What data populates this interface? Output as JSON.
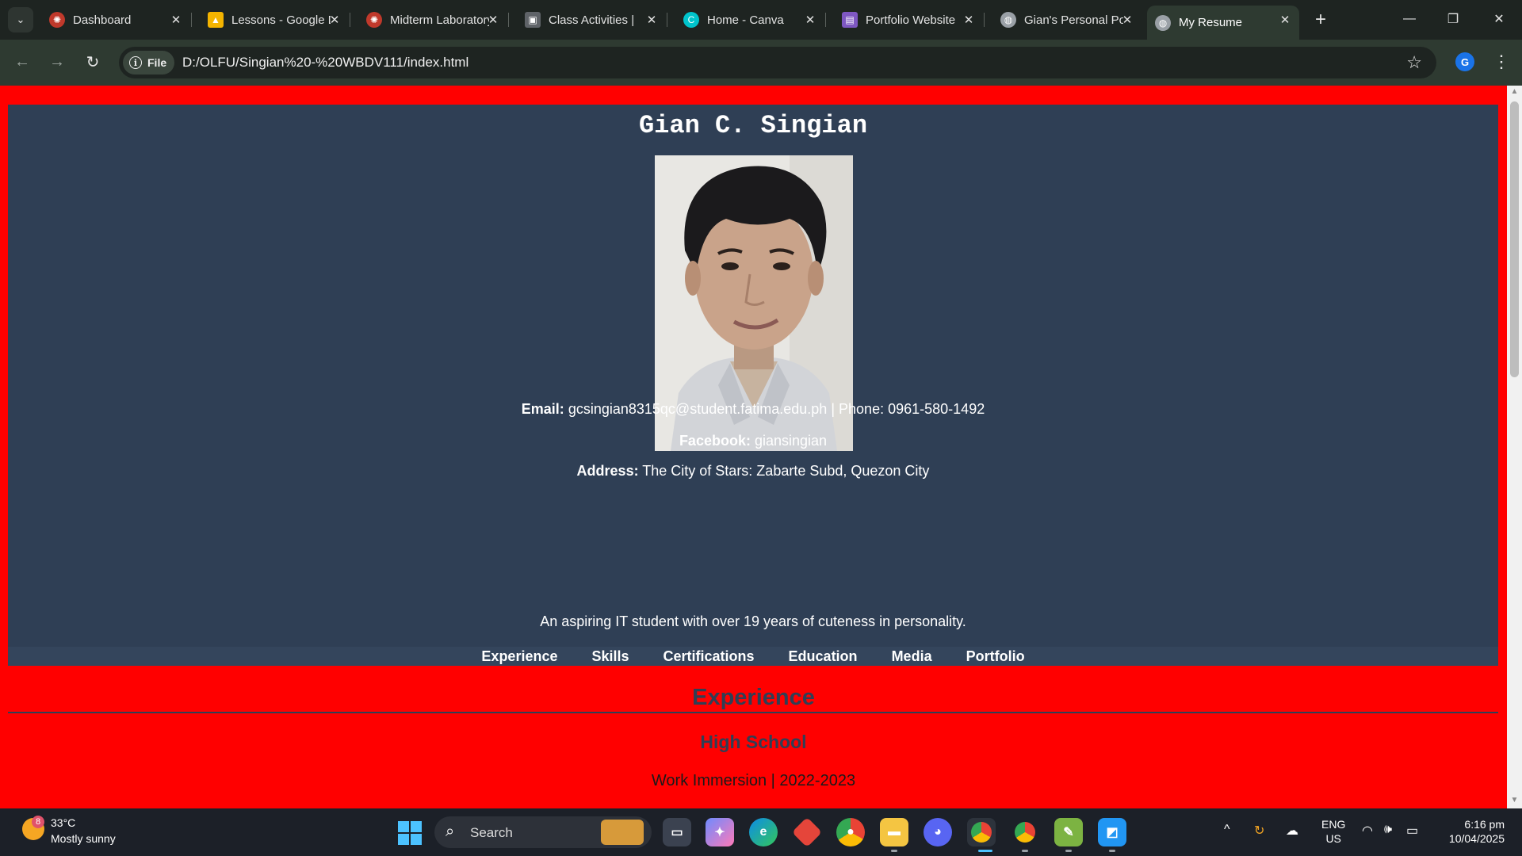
{
  "browser": {
    "tabs": [
      {
        "title": "Dashboard",
        "icon": "olfu-icon",
        "color": "#c0392b"
      },
      {
        "title": "Lessons - Google Drive",
        "icon": "google-drive-icon",
        "color": "#f4b400"
      },
      {
        "title": "Midterm Laboratory",
        "icon": "olfu-icon",
        "color": "#c0392b"
      },
      {
        "title": "Class Activities | ",
        "icon": "classroom-icon",
        "color": "#5f6368"
      },
      {
        "title": "Home - Canva",
        "icon": "canva-icon",
        "color": "#00c4cc"
      },
      {
        "title": "Portfolio Website",
        "icon": "sites-icon",
        "color": "#7e57c2"
      },
      {
        "title": "Gian's Personal Portfolio",
        "icon": "globe-icon",
        "color": "#9aa0a6"
      },
      {
        "title": "My Resume",
        "icon": "globe-icon",
        "color": "#9aa0a6",
        "active": true
      }
    ],
    "file_chip_label": "File",
    "url": "D:/OLFU/Singian%20-%20WBDV111/index.html",
    "profile_initial": "G"
  },
  "page": {
    "name": "Gian C. Singian",
    "email_label": "Email:",
    "email": "gcsingian8315qc@student.fatima.edu.ph",
    "phone_sep": "|",
    "phone_label": "Phone:",
    "phone": "0961-580-1492",
    "facebook_label": "Facebook:",
    "facebook": "giansingian",
    "address_label": "Address:",
    "address": "The City of Stars: Zabarte Subd, Quezon City",
    "tagline": "An aspiring IT student with over 19 years of cuteness in personality.",
    "nav": [
      "Experience",
      "Skills",
      "Certifications",
      "Education",
      "Media",
      "Portfolio"
    ],
    "section_title": "Experience",
    "sub_title": "High School",
    "item": "Work Immersion | 2022-2023",
    "colors": {
      "page_bg": "#ff0000",
      "panel_bg": "#2f3f55",
      "heading": "#2f3f55"
    }
  },
  "taskbar": {
    "weather_badge": "8",
    "temperature": "33°C",
    "condition": "Mostly sunny",
    "search_label": "Search",
    "lang_top": "ENG",
    "lang_bottom": "US",
    "time": "6:16 pm",
    "date": "10/04/2025"
  }
}
